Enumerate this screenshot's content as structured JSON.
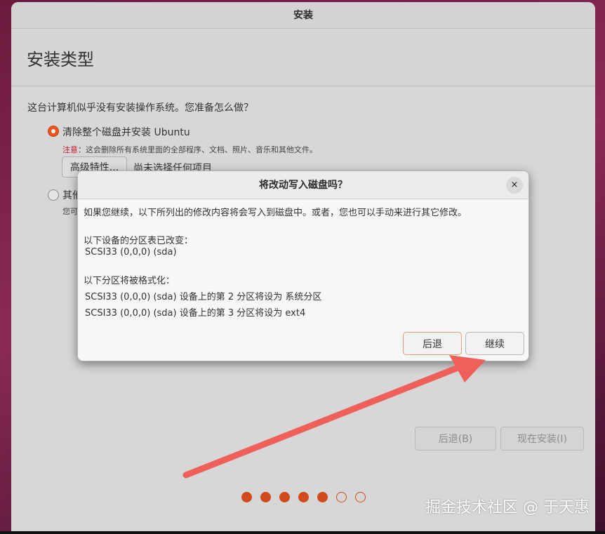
{
  "window": {
    "title": "安装"
  },
  "page": {
    "title": "安装类型"
  },
  "installer": {
    "question": "这台计算机似乎没有安装操作系统。您准备怎么做？",
    "option1_label": "清除整个磁盘并安装 Ubuntu",
    "warning_prefix": "注意",
    "warning_text": "：这会删除所有系统里面的全部程序、文档、照片、音乐和其他文件。",
    "advanced_button": "高级特性...",
    "advanced_status": "尚未选择任何项目",
    "option2_label": "其他",
    "option2_sub": "您可",
    "back_button": "后退(B)",
    "install_button": "现在安装(I)"
  },
  "progress_dots": {
    "total": 7,
    "completed": 5
  },
  "dialog": {
    "title": "将改动写入磁盘吗？",
    "close_icon": "×",
    "intro": "如果您继续，以下所列出的修改内容将会写入到磁盘中。或者，您也可以手动来进行其它修改。",
    "partition_table_header": "以下设备的分区表已改变：",
    "partition_table_device": "SCSI33 (0,0,0) (sda)",
    "format_header": "以下分区将被格式化：",
    "format_items": [
      "SCSI33 (0,0,0) (sda) 设备上的第 2 分区将设为 系统分区",
      "SCSI33 (0,0,0) (sda) 设备上的第 3 分区将设为 ext4"
    ],
    "back_button": "后退",
    "continue_button": "继续"
  },
  "watermark": "掘金技术社区 @ 于天惠",
  "colors": {
    "accent": "#e95420",
    "arrow": "#f0605a",
    "warning": "#c7162b"
  }
}
